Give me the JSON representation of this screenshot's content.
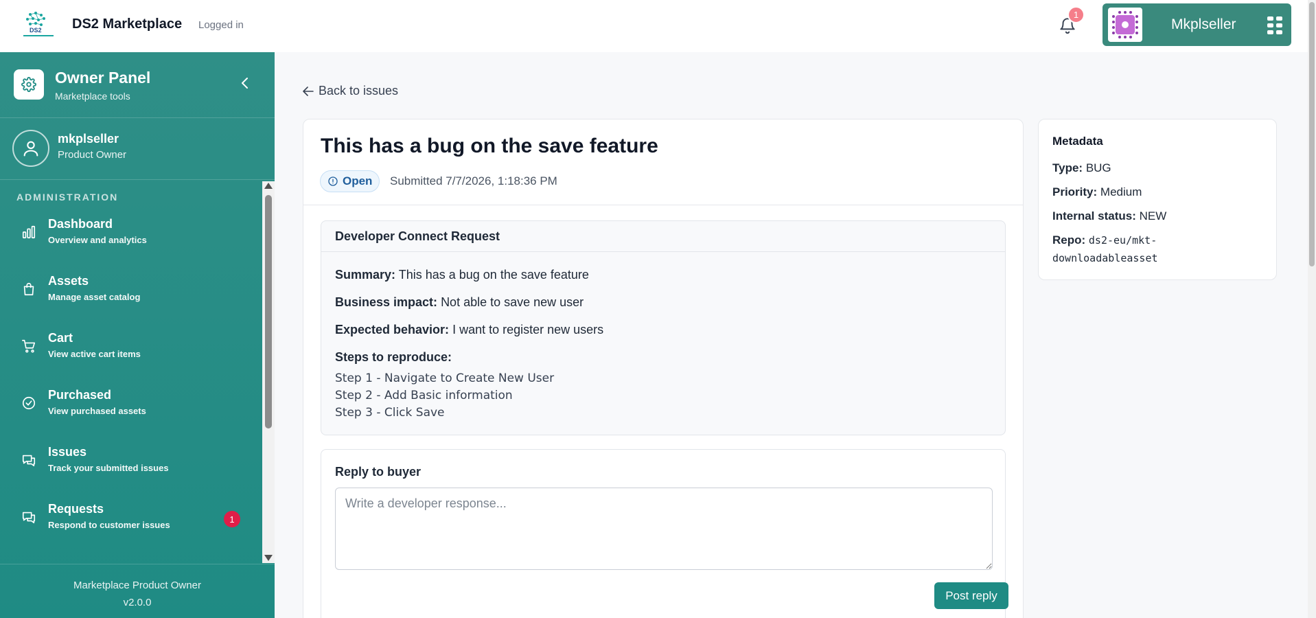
{
  "header": {
    "app_title": "DS2 Marketplace",
    "login_state": "Logged in",
    "notification_count": "1",
    "user_name": "Mkplseller"
  },
  "sidebar": {
    "panel_title": "Owner Panel",
    "panel_subtitle": "Marketplace tools",
    "profile_name": "mkplseller",
    "profile_role": "Product Owner",
    "section_label": "ADMINISTRATION",
    "items": [
      {
        "label": "Dashboard",
        "sub": "Overview and analytics",
        "icon": "bar-chart-icon"
      },
      {
        "label": "Assets",
        "sub": "Manage asset catalog",
        "icon": "shopping-bag-icon"
      },
      {
        "label": "Cart",
        "sub": "View active cart items",
        "icon": "cart-icon"
      },
      {
        "label": "Purchased",
        "sub": "View purchased assets",
        "icon": "check-circle-icon"
      },
      {
        "label": "Issues",
        "sub": "Track your submitted issues",
        "icon": "chat-bubbles-icon"
      },
      {
        "label": "Requests",
        "sub": "Respond to customer issues",
        "icon": "chat-bubbles-icon",
        "badge": "1"
      }
    ],
    "footer_title": "Marketplace Product Owner",
    "footer_version": "v2.0.0"
  },
  "main": {
    "back_label": "Back to issues",
    "issue_title": "This has a bug on the save feature",
    "status": "Open",
    "submitted": "Submitted 7/7/2026, 1:18:36 PM",
    "request": {
      "heading": "Developer Connect Request",
      "summary_label": "Summary:",
      "summary": "This has a bug on the save feature",
      "impact_label": "Business impact:",
      "impact": "Not able to save new user",
      "expected_label": "Expected behavior:",
      "expected": "I want to register new users",
      "steps_label": "Steps to reproduce:",
      "steps": [
        "Step 1 - Navigate to Create New User",
        "Step 2 - Add Basic information",
        "Step 3 - Click Save"
      ]
    },
    "reply": {
      "heading": "Reply to buyer",
      "placeholder": "Write a developer response...",
      "value": "",
      "button_label": "Post reply"
    }
  },
  "metadata": {
    "title": "Metadata",
    "type_label": "Type:",
    "type": "BUG",
    "priority_label": "Priority:",
    "priority": "Medium",
    "internal_label": "Internal status:",
    "internal": "NEW",
    "repo_label": "Repo:",
    "repo_line1": "ds2-eu/mkt-",
    "repo_line2": "downloadableasset"
  },
  "colors": {
    "sidebar": "#1f8b84",
    "accent": "#1f8b84",
    "user_chip": "#3a8a7d",
    "badge": "#e11d48",
    "status_open": "#1f5e9c"
  }
}
